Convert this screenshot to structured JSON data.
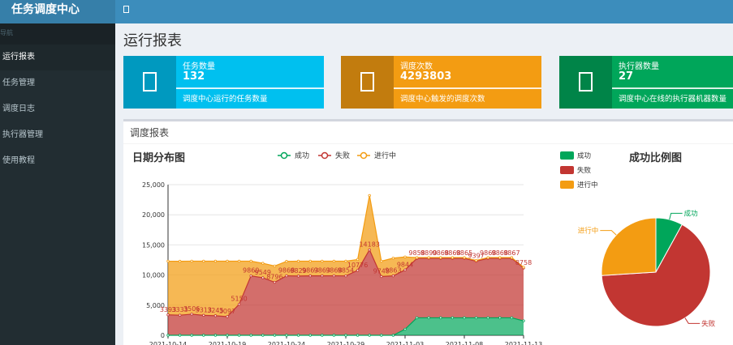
{
  "app": {
    "brand": "任务调度中心"
  },
  "sidebar": {
    "header": "导航",
    "items": [
      {
        "label": "运行报表",
        "active": true
      },
      {
        "label": "任务管理",
        "active": false
      },
      {
        "label": "调度日志",
        "active": false
      },
      {
        "label": "执行器管理",
        "active": false
      },
      {
        "label": "使用教程",
        "active": false
      }
    ]
  },
  "page": {
    "title": "运行报表"
  },
  "info_boxes": [
    {
      "label": "任务数量",
      "value": "132",
      "desc": "调度中心运行的任务数量",
      "color": "#00c0ef",
      "icon": "flag-icon"
    },
    {
      "label": "调度次数",
      "value": "4293803",
      "desc": "调度中心触发的调度次数",
      "color": "#f39c12",
      "icon": "calendar-icon"
    },
    {
      "label": "执行器数量",
      "value": "27",
      "desc": "调度中心在线的执行器机器数量",
      "color": "#00a65a",
      "icon": "desktop-icon"
    }
  ],
  "report": {
    "title": "调度报表"
  },
  "chart_data": [
    {
      "type": "area",
      "title": "日期分布图",
      "legend": [
        "成功",
        "失败",
        "进行中"
      ],
      "legend_position": "top",
      "colors": {
        "成功": "#00A65A",
        "失败": "#c23632",
        "进行中": "#F39C12"
      },
      "ylim": [
        0,
        25000
      ],
      "yticks": [
        "0",
        "5,000",
        "10,000",
        "15,000",
        "20,000",
        "25,000"
      ],
      "xtick_labels": [
        "2021-10-14",
        "2021-10-19",
        "2021-10-24",
        "2021-10-29",
        "2021-11-03",
        "2021-11-08",
        "2021-11-13"
      ],
      "x": [
        "2021-10-14",
        "2021-10-15",
        "2021-10-16",
        "2021-10-17",
        "2021-10-18",
        "2021-10-19",
        "2021-10-20",
        "2021-10-21",
        "2021-10-22",
        "2021-10-23",
        "2021-10-24",
        "2021-10-25",
        "2021-10-26",
        "2021-10-27",
        "2021-10-28",
        "2021-10-29",
        "2021-10-30",
        "2021-10-31",
        "2021-11-01",
        "2021-11-02",
        "2021-11-03",
        "2021-11-04",
        "2021-11-05",
        "2021-11-06",
        "2021-11-07",
        "2021-11-08",
        "2021-11-09",
        "2021-11-10",
        "2021-11-11",
        "2021-11-12",
        "2021-11-13"
      ],
      "series": [
        {
          "name": "成功",
          "values": [
            0,
            0,
            0,
            0,
            0,
            0,
            0,
            0,
            0,
            0,
            0,
            0,
            0,
            0,
            0,
            0,
            0,
            0,
            0,
            0,
            1000,
            2900,
            2900,
            2900,
            2900,
            2900,
            2900,
            2900,
            2900,
            2900,
            2400
          ]
        },
        {
          "name": "失败",
          "values": [
            3393,
            3333,
            3506,
            3313,
            3245,
            3097,
            5150,
            9860,
            9549,
            8796,
            9868,
            9829,
            9863,
            9863,
            9868,
            9854,
            10776,
            14183,
            9748,
            9863,
            9844,
            9858,
            9890,
            9868,
            9868,
            9865,
            9397,
            9868,
            9868,
            9867,
            8758
          ]
        },
        {
          "name": "进行中",
          "values": [
            8900,
            8950,
            8800,
            8990,
            9055,
            9200,
            7150,
            2440,
            2400,
            2704,
            2400,
            2471,
            2437,
            2437,
            2432,
            2446,
            1800,
            9017,
            2552,
            2937,
            2156,
            142,
            110,
            132,
            132,
            135,
            130,
            132,
            132,
            133,
            142
          ]
        }
      ],
      "data_labels": [
        "3393",
        "3333",
        "3506",
        "3313",
        "3245",
        "3097",
        "5150",
        "9860",
        "9549",
        "8796",
        "9868",
        "9829",
        "9863",
        "9863",
        "9868",
        "9854",
        "10776",
        "14183",
        "9748",
        "9863",
        "9844",
        "9858",
        "9890",
        "9868",
        "9868",
        "9865",
        "9397",
        "9868",
        "9868",
        "9867",
        "8758"
      ]
    },
    {
      "type": "pie",
      "title": "成功比例图",
      "legend": [
        "成功",
        "失败",
        "进行中"
      ],
      "legend_position": "left",
      "slices": [
        {
          "label": "成功",
          "value": 8,
          "color": "#00A65A"
        },
        {
          "label": "失败",
          "value": 66,
          "color": "#c23632"
        },
        {
          "label": "进行中",
          "value": 26,
          "color": "#F39C12"
        }
      ]
    }
  ]
}
